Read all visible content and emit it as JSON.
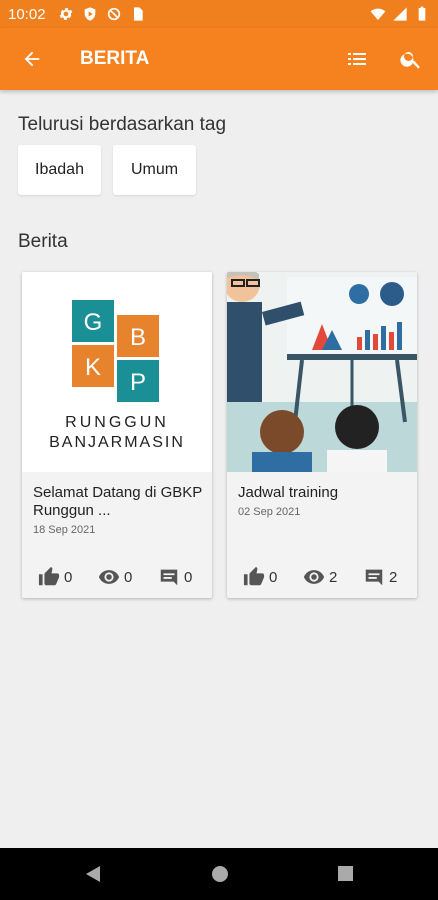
{
  "status_bar": {
    "time": "10:02"
  },
  "app_bar": {
    "title": "BERITA"
  },
  "tags": {
    "heading": "Telurusi berdasarkan tag",
    "items": [
      "Ibadah",
      "Umum"
    ]
  },
  "news": {
    "heading": "Berita",
    "items": [
      {
        "title": "Selamat Datang di GBKP Runggun ...",
        "date": "18 Sep 2021",
        "likes": "0",
        "views": "0",
        "comments": "0",
        "logo": {
          "letters": [
            "G",
            "B",
            "K",
            "P"
          ],
          "line1": "RUNGGUN",
          "line2": "BANJARMASIN"
        }
      },
      {
        "title": "Jadwal training",
        "date": "02 Sep 2021",
        "likes": "0",
        "views": "2",
        "comments": "2"
      }
    ]
  },
  "colors": {
    "primary": "#f5821f",
    "status": "#f07f1e",
    "logo_teal": "#1a8f96",
    "logo_orange": "#e7832d"
  }
}
